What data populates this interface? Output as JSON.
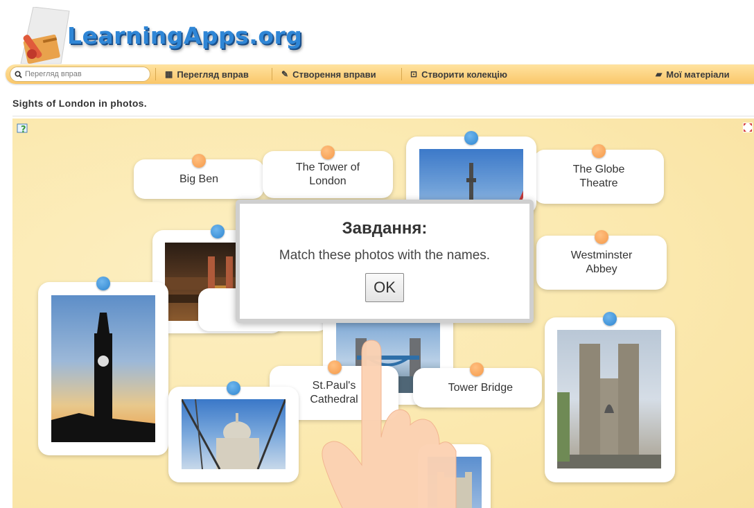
{
  "header": {
    "logo_text": "LearningApps.org"
  },
  "nav": {
    "search_placeholder": "Перегляд вправ",
    "browse": "Перегляд вправ",
    "create": "Створення вправи",
    "collection": "Створити колекцію",
    "materials": "Мої матеріали"
  },
  "page": {
    "title": "Sights of London in photos."
  },
  "cards": {
    "big_ben": "Big Ben",
    "tower_of_london": "The Tower of London",
    "globe": "The Globe Theatre",
    "westminster": "Westminster Abbey",
    "st_pauls": "St.Paul's Cathedral",
    "tower_bridge": "Tower Bridge"
  },
  "dialog": {
    "title": "Завдання:",
    "text": "Match these photos with the names.",
    "ok": "OK"
  },
  "colors": {
    "nav_bg": "#fac769",
    "board_bg": "#fbeab2",
    "pin_orange": "#f59a4a",
    "pin_blue": "#2f86d0"
  }
}
